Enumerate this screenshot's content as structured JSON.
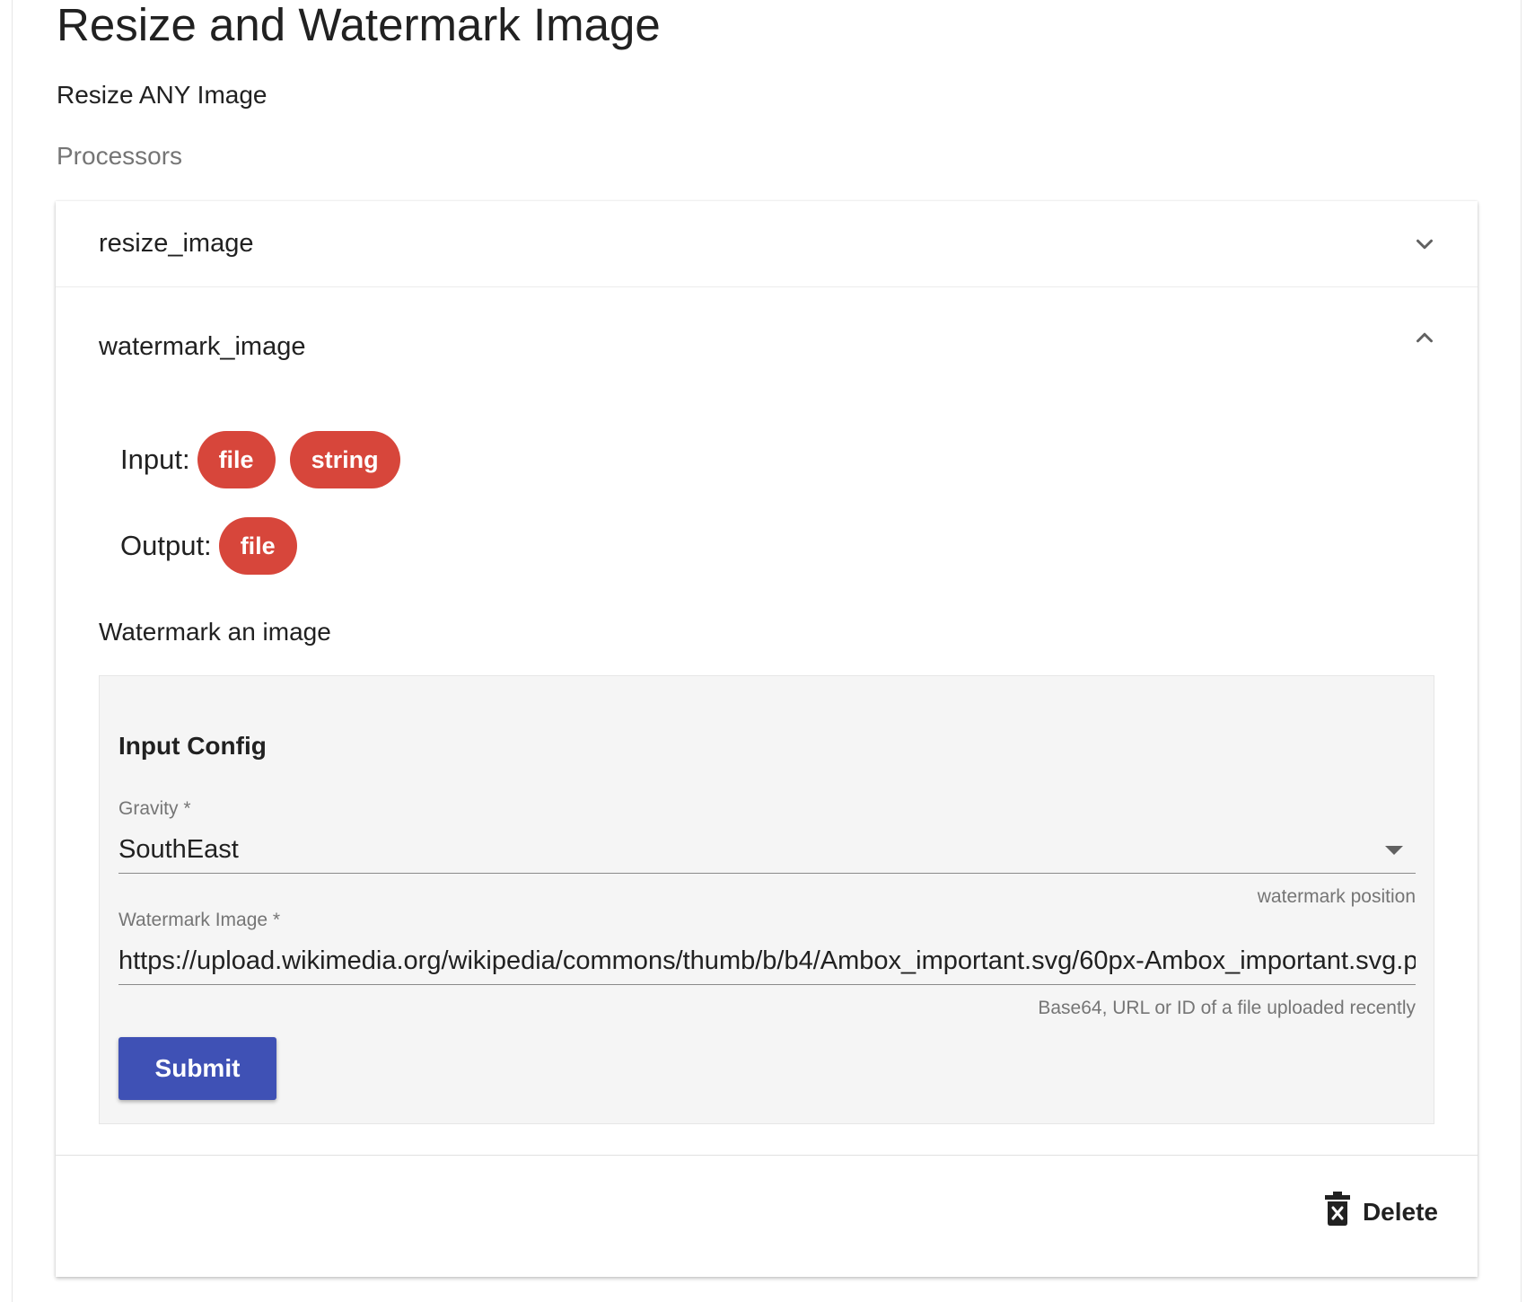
{
  "page": {
    "title": "Resize and Watermark Image",
    "subtitle": "Resize ANY Image",
    "section_label": "Processors"
  },
  "processors": [
    {
      "name": "resize_image",
      "expanded": false,
      "chevron_icon": "chevron-down-icon"
    },
    {
      "name": "watermark_image",
      "expanded": true,
      "chevron_icon": "chevron-up-icon",
      "input_label": "Input:",
      "inputs": [
        "file",
        "string"
      ],
      "output_label": "Output:",
      "outputs": [
        "file"
      ],
      "description": "Watermark an image",
      "config": {
        "title": "Input Config",
        "gravity": {
          "label": "Gravity *",
          "value": "SouthEast",
          "helper": "watermark position"
        },
        "watermark_image": {
          "label": "Watermark Image *",
          "value": "https://upload.wikimedia.org/wikipedia/commons/thumb/b/b4/Ambox_important.svg/60px-Ambox_important.svg.p",
          "helper": "Base64, URL or ID of a file uploaded recently"
        },
        "submit_label": "Submit"
      }
    }
  ],
  "footer": {
    "delete_label": "Delete",
    "delete_icon": "trash-icon"
  },
  "colors": {
    "chip": "#d7463b",
    "primary": "#3f51b5",
    "config_background": "#f5f5f5"
  }
}
